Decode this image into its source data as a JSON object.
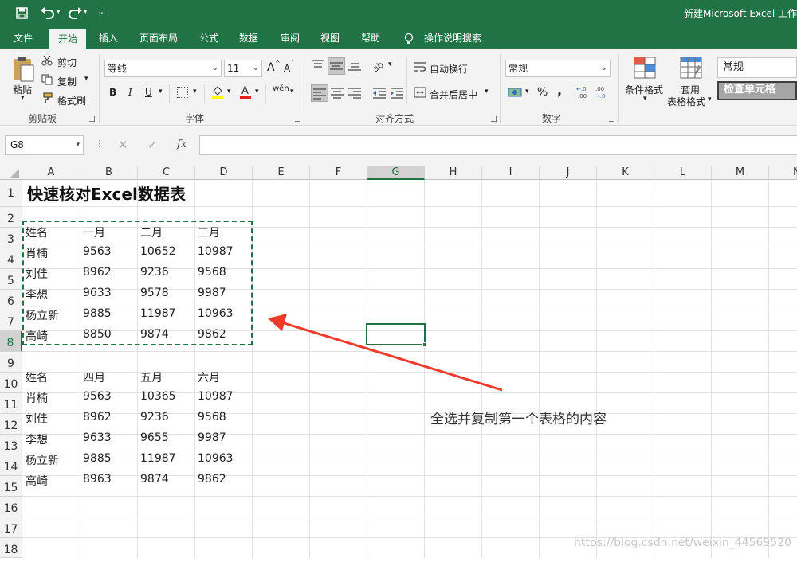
{
  "titlebar": {
    "title": "新建Microsoft Excel 工作"
  },
  "menu": {
    "items": [
      "文件",
      "开始",
      "插入",
      "页面布局",
      "公式",
      "数据",
      "审阅",
      "视图",
      "帮助",
      "操作说明搜索"
    ],
    "active": "开始"
  },
  "ribbon": {
    "clipboard": {
      "paste": "粘贴",
      "cut": "剪切",
      "copy": "复制",
      "format_painter": "格式刷",
      "label": "剪贴板"
    },
    "font": {
      "name": "等线",
      "size": "11",
      "label": "字体",
      "grow": "A",
      "shrink": "A",
      "bold": "B",
      "italic": "I",
      "underline": "U",
      "phonetic": "wén"
    },
    "alignment": {
      "wrap": "自动换行",
      "merge": "合并后居中",
      "label": "对齐方式"
    },
    "number": {
      "format": "常规",
      "percent": "%",
      "comma": ",",
      "inc_decimal": "←.0\n.00",
      "dec_decimal": ".00\n→.0",
      "label": "数字"
    },
    "styles": {
      "conditional": "条件格式",
      "table_format_1": "套用",
      "table_format_2": "表格格式",
      "style_normal": "常规",
      "style_check": "检查单元格"
    }
  },
  "formula_bar": {
    "name_box": "G8",
    "fx": "fx",
    "value": ""
  },
  "columns": [
    "A",
    "B",
    "C",
    "D",
    "E",
    "F",
    "G",
    "H",
    "I",
    "J",
    "K",
    "L",
    "M",
    "N"
  ],
  "rows": [
    "1",
    "2",
    "3",
    "4",
    "5",
    "6",
    "7",
    "8",
    "9",
    "10",
    "11",
    "12",
    "13",
    "14",
    "15",
    "16",
    "17",
    "18"
  ],
  "sheet": {
    "title": "快速核对Excel数据表",
    "table1": {
      "headers": [
        "姓名",
        "一月",
        "二月",
        "三月"
      ],
      "rows": [
        [
          "肖楠",
          "9563",
          "10652",
          "10987"
        ],
        [
          "刘佳",
          "8962",
          "9236",
          "9568"
        ],
        [
          "李想",
          "9633",
          "9578",
          "9987"
        ],
        [
          "杨立新",
          "9885",
          "11987",
          "10963"
        ],
        [
          "高崎",
          "8850",
          "9874",
          "9862"
        ]
      ]
    },
    "table2": {
      "headers": [
        "姓名",
        "四月",
        "五月",
        "六月"
      ],
      "rows": [
        [
          "肖楠",
          "9563",
          "10365",
          "10987"
        ],
        [
          "刘佳",
          "8962",
          "9236",
          "9568"
        ],
        [
          "李想",
          "9633",
          "9655",
          "9987"
        ],
        [
          "杨立新",
          "9885",
          "11987",
          "10963"
        ],
        [
          "高崎",
          "8963",
          "9874",
          "9862"
        ]
      ]
    },
    "selected_cell": "G8"
  },
  "annotation": {
    "text": "全选并复制第一个表格的内容",
    "color": "#f03a2a"
  },
  "watermark": "https://blog.csdn.net/weixin_44569520",
  "colors": {
    "excel_green": "#217346",
    "ribbon_bg": "#f3f3f3",
    "copy_marquee": "#217346"
  }
}
